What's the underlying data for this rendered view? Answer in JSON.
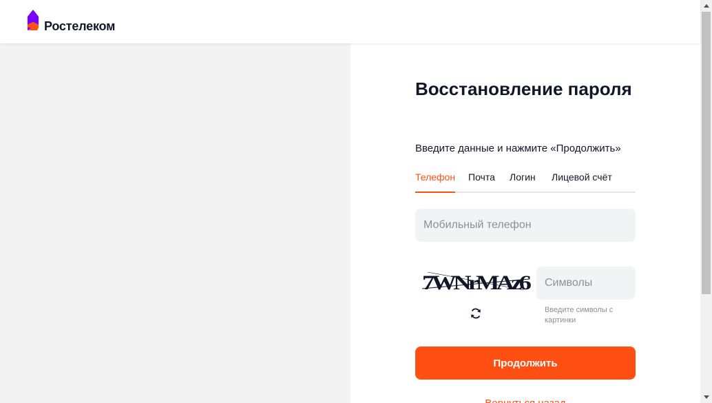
{
  "header": {
    "logo_text": "Ростелеком"
  },
  "form": {
    "title": "Восстановление пароля",
    "subtitle": "Введите данные и нажмите «Продолжить»",
    "tabs": [
      {
        "label": "Телефон",
        "active": true
      },
      {
        "label": "Почта",
        "active": false
      },
      {
        "label": "Логин",
        "active": false
      },
      {
        "label": "Лицевой счёт",
        "active": false
      }
    ],
    "phone_placeholder": "Мобильный телефон",
    "captcha_text": "7WNrMAz6",
    "captcha_placeholder": "Символы",
    "captcha_hint": "Введите символы с картинки",
    "continue_label": "Продолжить",
    "back_label": "Вернуться назад"
  },
  "colors": {
    "accent": "#ff4f12",
    "text": "#101828",
    "muted": "#8a8f98",
    "panel": "#f3f3f3",
    "input_bg": "#f2f3f5",
    "logo_purple": "#7700ff"
  },
  "icons": {
    "refresh": "refresh-icon",
    "scroll_up": "arrow-up-icon",
    "scroll_down": "arrow-down-icon"
  }
}
